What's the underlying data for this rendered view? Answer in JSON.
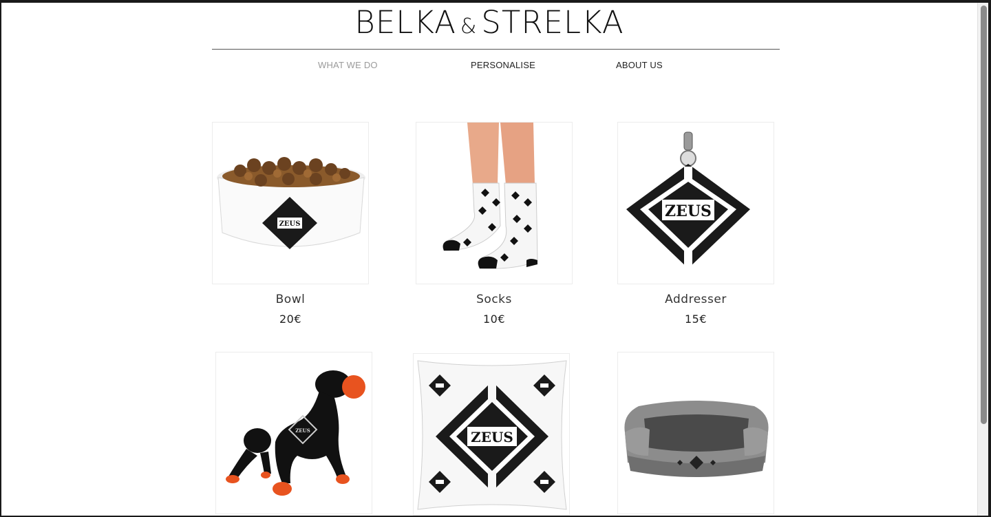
{
  "brand": {
    "left": "BELKA",
    "amp": "&",
    "right": "STRELKA"
  },
  "nav": [
    {
      "label": "WHAT WE DO"
    },
    {
      "label": "PERSONALISE"
    },
    {
      "label": "ABOUT US"
    }
  ],
  "products": [
    {
      "name": "Bowl",
      "price": "20€",
      "icon": "pet-bowl-image"
    },
    {
      "name": "Socks",
      "price": "10€",
      "icon": "socks-image"
    },
    {
      "name": "Addresser",
      "price": "15€",
      "icon": "tag-pendant-image"
    },
    {
      "name": "",
      "price": "",
      "icon": "dog-toy-image"
    },
    {
      "name": "",
      "price": "",
      "icon": "pillow-image"
    },
    {
      "name": "",
      "price": "",
      "icon": "pet-bed-image"
    }
  ],
  "logo_text": "ZEUS"
}
